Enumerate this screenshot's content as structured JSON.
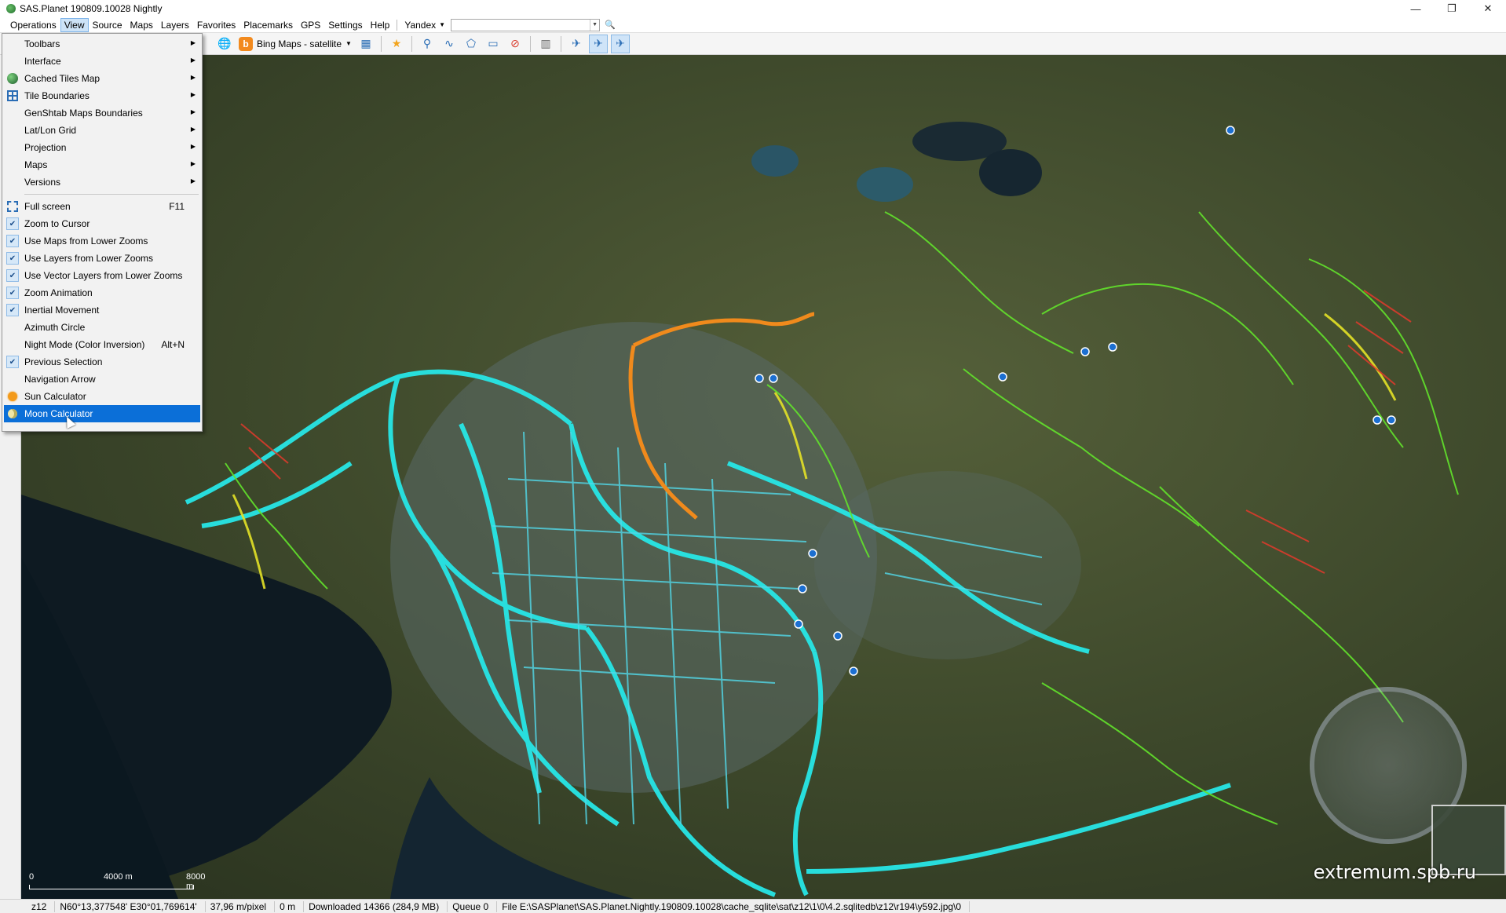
{
  "window": {
    "title": "SAS.Planet 190809.10028 Nightly",
    "controls": [
      "—",
      "❐",
      "✕"
    ]
  },
  "menubar": {
    "items": [
      "Operations",
      "View",
      "Source",
      "Maps",
      "Layers",
      "Favorites",
      "Placemarks",
      "GPS",
      "Settings",
      "Help"
    ],
    "active": "View",
    "search_provider": "Yandex",
    "search_value": ""
  },
  "toolbar": {
    "map_source": "Bing Maps - satellite"
  },
  "view_menu": {
    "items": [
      {
        "label": "Toolbars",
        "submenu": true
      },
      {
        "label": "Interface",
        "submenu": true
      },
      {
        "label": "Cached Tiles Map",
        "submenu": true,
        "icon": "globe-icon"
      },
      {
        "label": "Tile Boundaries",
        "submenu": true,
        "icon": "tile-grid-icon"
      },
      {
        "label": "GenShtab Maps Boundaries",
        "submenu": true
      },
      {
        "label": "Lat/Lon Grid",
        "submenu": true
      },
      {
        "label": "Projection",
        "submenu": true
      },
      {
        "label": "Maps",
        "submenu": true
      },
      {
        "label": "Versions",
        "submenu": true
      }
    ],
    "items2": [
      {
        "label": "Full screen",
        "shortcut": "F11",
        "icon": "fullscreen-icon"
      },
      {
        "label": "Zoom to Cursor",
        "checked": true
      },
      {
        "label": "Use Maps from Lower Zooms",
        "checked": true
      },
      {
        "label": "Use Layers from Lower Zooms",
        "checked": true
      },
      {
        "label": "Use Vector Layers from Lower Zooms",
        "checked": true
      },
      {
        "label": "Zoom Animation",
        "checked": true
      },
      {
        "label": "Inertial Movement",
        "checked": true
      },
      {
        "label": "Azimuth Circle",
        "checked": false
      },
      {
        "label": "Night Mode (Color Inversion)",
        "shortcut": "Alt+N",
        "checked": false
      },
      {
        "label": "Previous Selection",
        "checked": true
      },
      {
        "label": "Navigation Arrow",
        "checked": false
      },
      {
        "label": "Sun Calculator",
        "icon": "sun-icon"
      },
      {
        "label": "Moon Calculator",
        "icon": "moon-icon",
        "highlighted": true
      }
    ]
  },
  "map": {
    "scale_labels": [
      "0",
      "4000 m",
      "8000 m"
    ],
    "watermark": "extremum.spb.ru"
  },
  "statusbar": {
    "zoom": "z12",
    "coords": "N60°13,377548' E30°01,769614'",
    "resolution": "37,96 m/pixel",
    "distance": "0 m",
    "downloaded": "Downloaded 14366 (284,9 MB)",
    "queue": "Queue 0",
    "file": "File E:\\SASPlanet\\SAS.Planet.Nightly.190809.10028\\cache_sqlite\\sat\\z12\\1\\0\\4.2.sqlitedb\\z12\\r194\\y592.jpg\\0"
  }
}
